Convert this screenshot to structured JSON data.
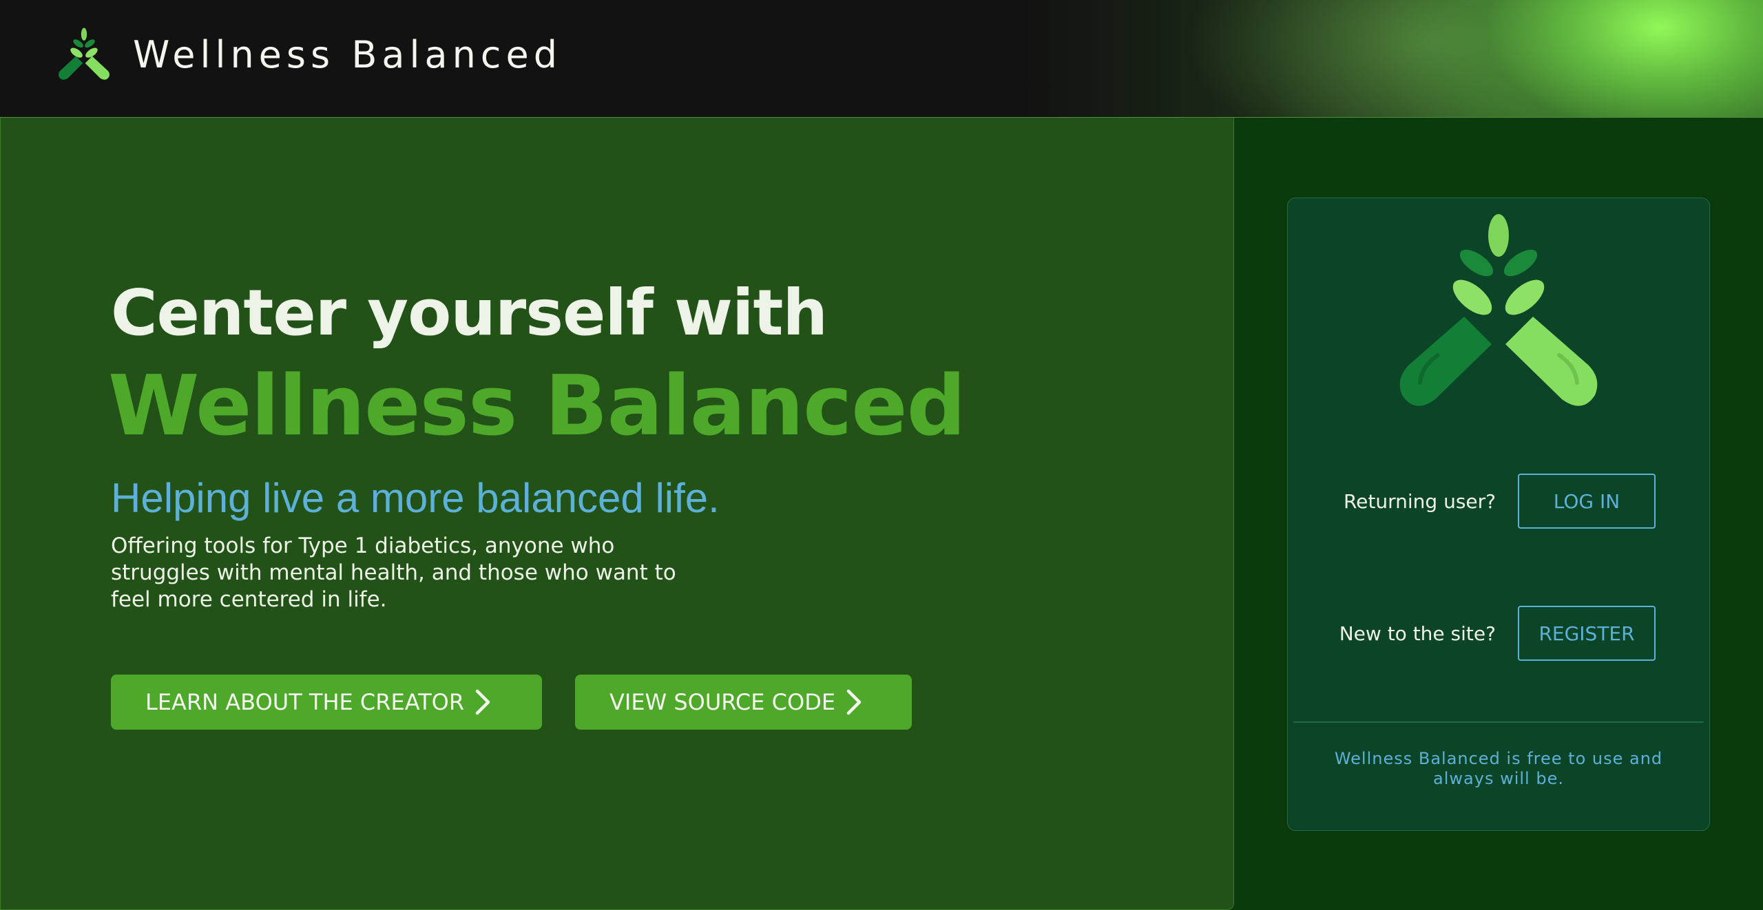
{
  "header": {
    "site_title": "Wellness Balanced",
    "logo_icon": "leaf-capsule-logo-icon"
  },
  "hero": {
    "heading": "Center yourself with",
    "brand": "Wellness Balanced",
    "tagline": "Helping live a more balanced life.",
    "description": "Offering tools for Type 1 diabetics, anyone who struggles with mental health, and those who want to feel more centered in life.",
    "buttons": [
      {
        "label": "LEARN ABOUT THE CREATOR",
        "icon": "chevron-right-icon"
      },
      {
        "label": "VIEW SOURCE CODE",
        "icon": "chevron-right-icon"
      }
    ]
  },
  "auth": {
    "logo_icon": "leaf-capsule-logo-icon",
    "login_prompt": "Returning user?",
    "login_label": "LOG IN",
    "register_prompt": "New to the site?",
    "register_label": "REGISTER",
    "footer_note": "Wellness Balanced is free to use and always will be."
  },
  "colors": {
    "brand_green": "#4ea82a",
    "hero_background": "#225217",
    "card_background": "#0c4427",
    "accent_blue": "#5db1d8",
    "header_background": "#121212",
    "text_light": "#eef3e8"
  }
}
